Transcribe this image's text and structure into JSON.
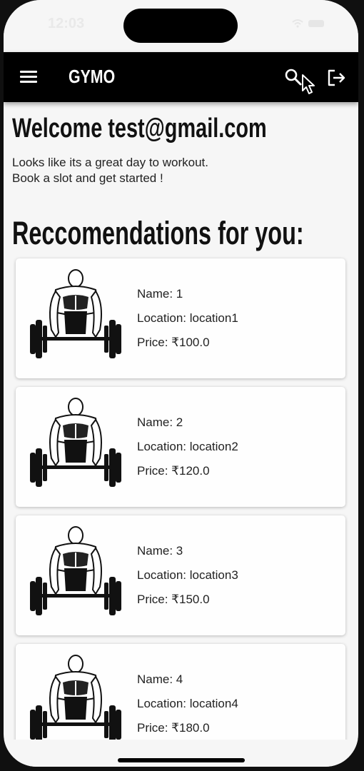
{
  "status": {
    "time": "12:03"
  },
  "appbar": {
    "title": "GYMO"
  },
  "welcome": "Welcome test@gmail.com",
  "subtitle": {
    "line1": "Looks like its a great day to workout.",
    "line2": "Book a slot and get started !"
  },
  "recommendations_title": "Reccomendations for you:",
  "cards": [
    {
      "name": "Name: 1",
      "location": "Location: location1",
      "price": "Price: ₹100.0"
    },
    {
      "name": "Name: 2",
      "location": "Location: location2",
      "price": "Price: ₹120.0"
    },
    {
      "name": "Name: 3",
      "location": "Location: location3",
      "price": "Price: ₹150.0"
    },
    {
      "name": "Name: 4",
      "location": "Location: location4",
      "price": "Price: ₹180.0"
    }
  ],
  "icons": {
    "menu": "menu-icon",
    "search": "search-icon",
    "logout": "logout-icon",
    "card_image": "bodybuilder-deadlift-illustration"
  },
  "colors": {
    "appbar": "#000000",
    "background": "#f6f6f6",
    "card": "#fefefe"
  }
}
